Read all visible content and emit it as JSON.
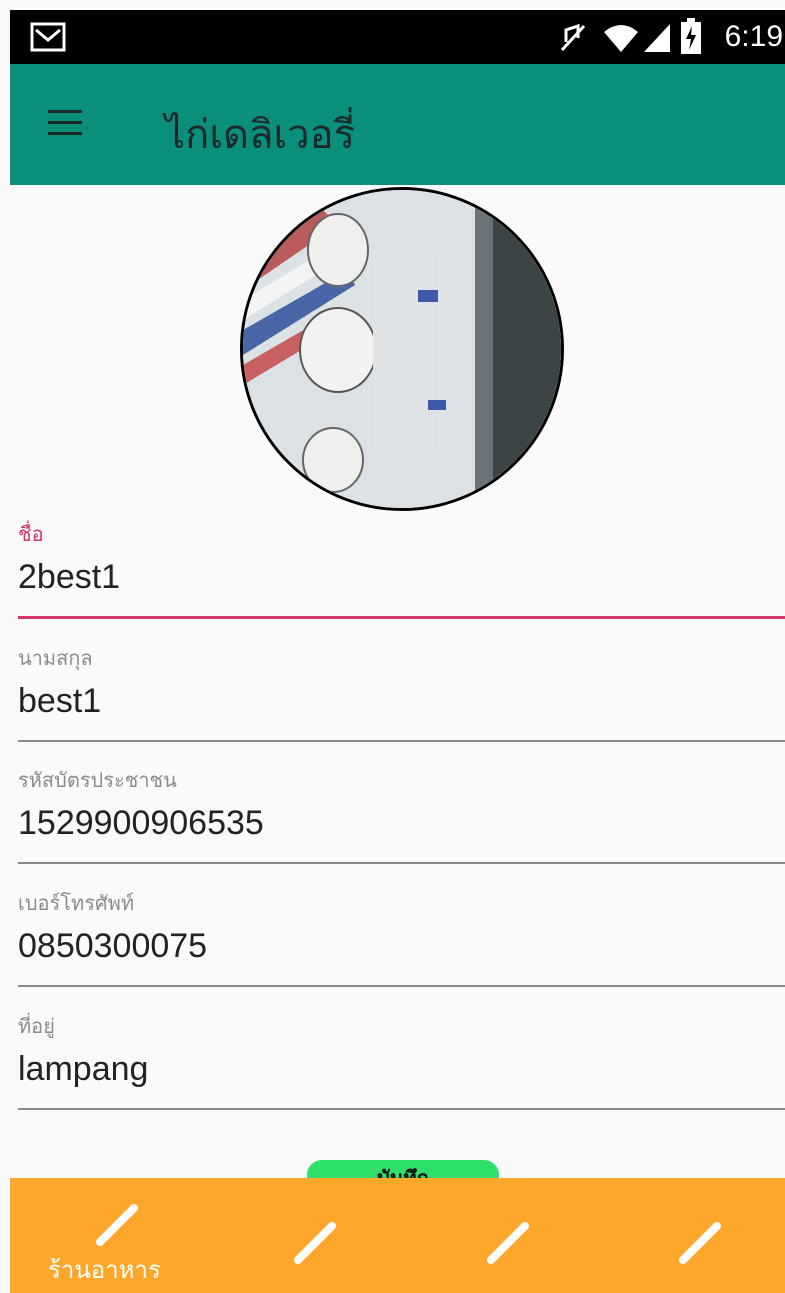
{
  "status_bar": {
    "time": "6:19",
    "icons": [
      "gmail-icon",
      "mute-icon",
      "wifi-icon",
      "signal-icon",
      "battery-charging-icon"
    ]
  },
  "app_bar": {
    "title": "ไก่เดลิเวอรี่",
    "menu_icon": "hamburger-menu-icon",
    "color": "#0a8f7a"
  },
  "profile": {
    "avatar_description": "profile-photo"
  },
  "form": {
    "fields": [
      {
        "label": "ชื่อ",
        "value": "2best1"
      },
      {
        "label": "นามสกุล",
        "value": "best1"
      },
      {
        "label": "รหัสบัตรประชาชน",
        "value": "1529900906535"
      },
      {
        "label": "เบอร์โทรศัพท์",
        "value": "0850300075"
      },
      {
        "label": "ที่อยู่",
        "value": "lampang"
      }
    ],
    "accent_color": "#d6336c"
  },
  "save_button": {
    "label": "บันทึก",
    "color": "#2ee06a"
  },
  "bottom_nav": {
    "color": "#ffa72a",
    "items": [
      {
        "label": "ร้านอาหาร",
        "icon": "pencil-icon"
      },
      {
        "label": "",
        "icon": "pencil-icon"
      },
      {
        "label": "",
        "icon": "pencil-icon"
      },
      {
        "label": "",
        "icon": "pencil-icon"
      }
    ]
  }
}
